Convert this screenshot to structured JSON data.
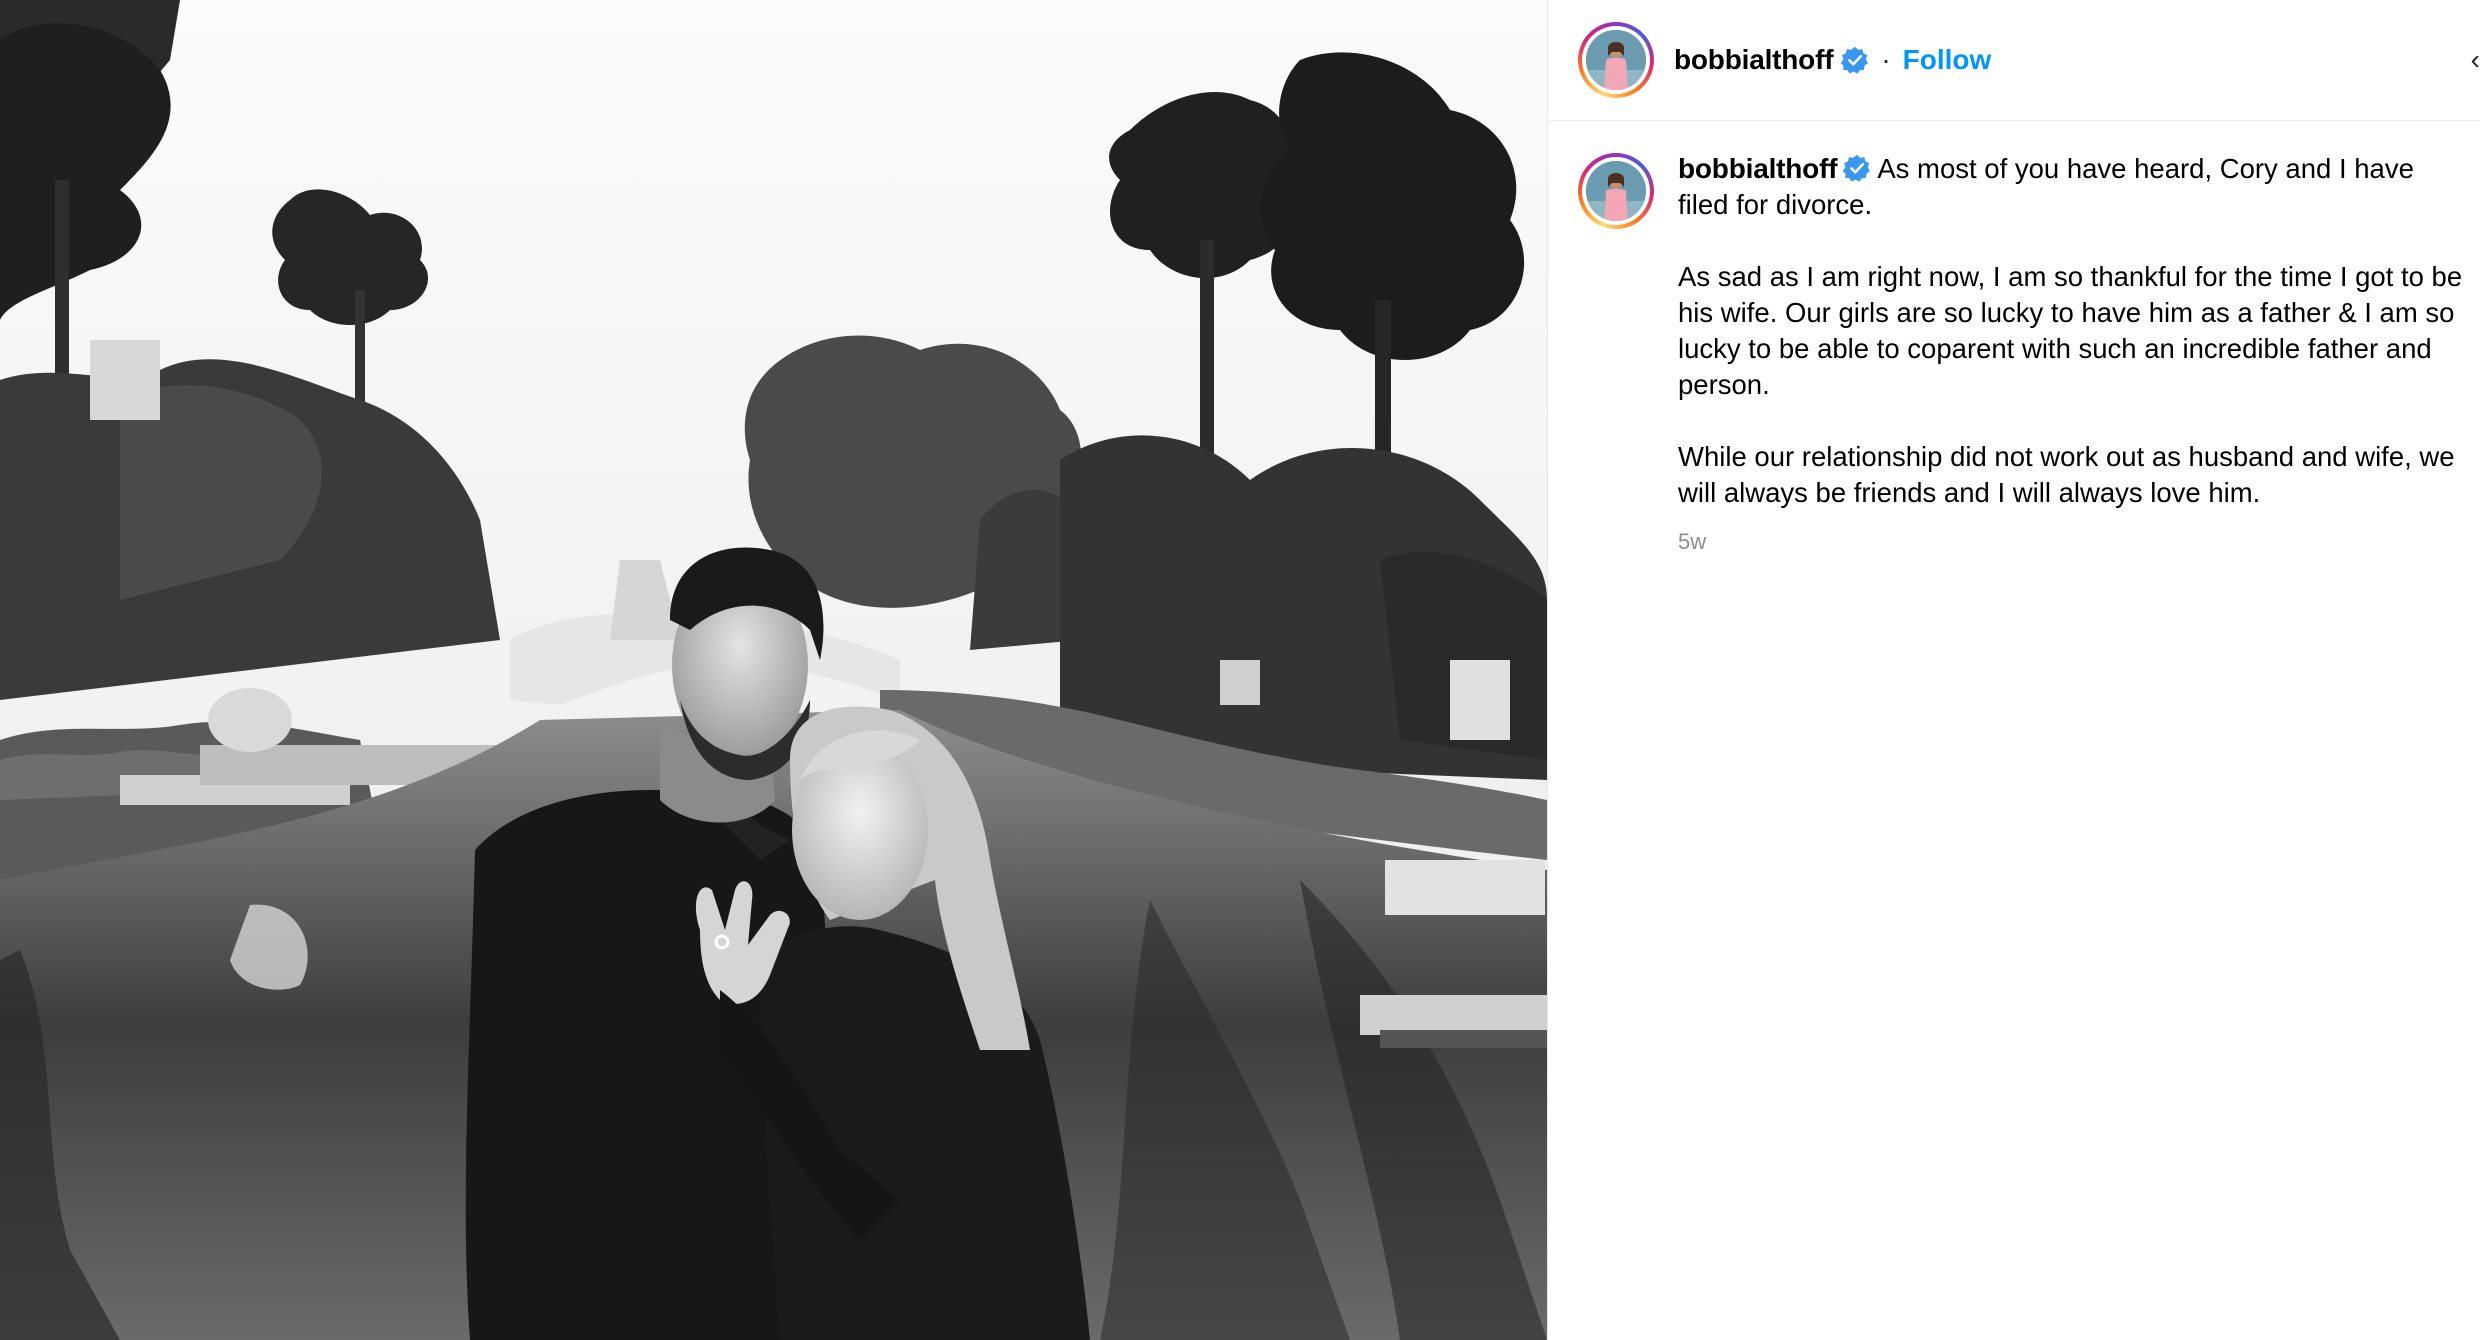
{
  "post": {
    "username": "bobbialthoff",
    "verified": true,
    "follow_label": "Follow",
    "separator": "·",
    "caption": "As most of you have heard, Cory and I have filed for divorce.\n\nAs sad as I am right now, I am so thankful for the time I got to be his wife. Our girls are so lucky to have him as a father & I am so lucky to be able to coparent with such an incredible father and person.\n\nWhile our relationship did not work out as husband and wife, we will always be friends and I will always love him.",
    "timestamp": "5w"
  },
  "icons": {
    "verified": "verified-badge-icon",
    "more": "more-options-icon"
  },
  "colors": {
    "follow_blue": "#0095f6",
    "verified_blue": "#3897f0",
    "timestamp_gray": "#8e8e8e"
  }
}
